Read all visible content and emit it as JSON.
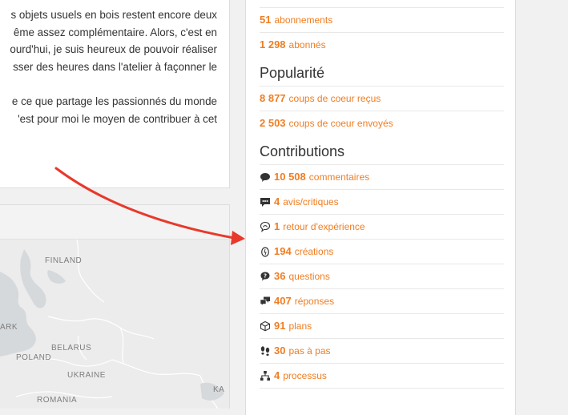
{
  "text": {
    "p1_lines": [
      "s objets usuels en bois restent encore deux",
      "ême assez complémentaire. Alors, c'est en",
      "ourd'hui, je suis heureux de pouvoir réaliser",
      "sser des heures dans l'atelier à façonner le"
    ],
    "p2_lines": [
      "e ce que partage les passionnés du monde",
      "'est pour moi le moyen de contribuer à cet"
    ]
  },
  "map": {
    "labels": [
      "FINLAND",
      "BELARUS",
      "POLAND",
      "UKRAINE",
      "ROMANIA",
      "ARK",
      "KA"
    ]
  },
  "stats": {
    "top": [
      {
        "num": "51",
        "label": "abonnements"
      },
      {
        "num": "1 298",
        "label": "abonnés"
      }
    ],
    "popularity_heading": "Popularité",
    "popularity": [
      {
        "num": "8 877",
        "label": "coups de coeur reçus"
      },
      {
        "num": "2 503",
        "label": "coups de coeur envoyés"
      }
    ],
    "contributions_heading": "Contributions",
    "contributions": [
      {
        "icon": "comment-icon",
        "num": "10 508",
        "label": "commentaires"
      },
      {
        "icon": "review-icon",
        "num": "4",
        "label": "avis/critiques"
      },
      {
        "icon": "feedback-icon",
        "num": "1",
        "label": "retour d'expérience"
      },
      {
        "icon": "creation-icon",
        "num": "194",
        "label": "créations"
      },
      {
        "icon": "question-icon",
        "num": "36",
        "label": "questions"
      },
      {
        "icon": "answers-icon",
        "num": "407",
        "label": "réponses"
      },
      {
        "icon": "cube-icon",
        "num": "91",
        "label": "plans"
      },
      {
        "icon": "footsteps-icon",
        "num": "30",
        "label": "pas à pas"
      },
      {
        "icon": "process-icon",
        "num": "4",
        "label": "processus"
      }
    ]
  },
  "colors": {
    "accent": "#f07d22",
    "arrow": "#e8392b"
  }
}
